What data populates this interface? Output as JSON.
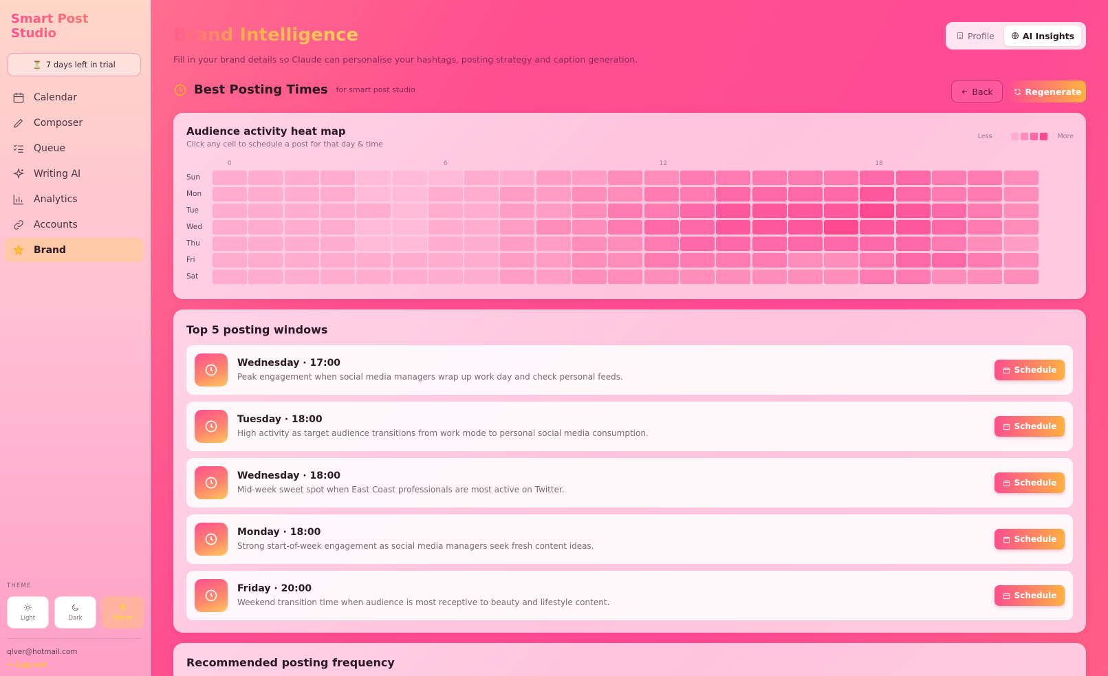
{
  "app": {
    "name": "Smart Post Studio",
    "trial": "7 days left in trial"
  },
  "sidebar": {
    "items": [
      {
        "label": "Calendar",
        "icon": "calendar-icon"
      },
      {
        "label": "Composer",
        "icon": "pen-icon"
      },
      {
        "label": "Queue",
        "icon": "list-check-icon"
      },
      {
        "label": "Writing AI",
        "icon": "sparkle-icon"
      },
      {
        "label": "Analytics",
        "icon": "bar-chart-icon"
      },
      {
        "label": "Accounts",
        "icon": "link-icon"
      },
      {
        "label": "Brand",
        "icon": "star-icon",
        "active": true
      }
    ],
    "theme_label": "THEME",
    "themes": [
      {
        "label": "Light",
        "icon": "sun-icon"
      },
      {
        "label": "Dark",
        "icon": "moon-icon"
      },
      {
        "label": "Warm",
        "icon": "bulb-icon",
        "active": true
      }
    ],
    "email": "qlver@hotmail.com",
    "logout": "Log out"
  },
  "header": {
    "title": "Brand Intelligence",
    "subtitle": "Fill in your brand details so Claude can personalise your hashtags, posting strategy and caption generation.",
    "tabs": [
      {
        "label": "Profile",
        "icon": "building-icon"
      },
      {
        "label": "AI Insights",
        "icon": "globe-icon",
        "active": true
      }
    ]
  },
  "section": {
    "title": "Best Posting Times",
    "subtitle": "for smart post studio",
    "back_label": "Back",
    "regenerate_label": "Regenerate"
  },
  "heatmap": {
    "title": "Audience activity heat map",
    "subtitle": "Click any cell to schedule a post for that day & time",
    "legend_less": "Less",
    "legend_more": "More",
    "hour_labels": [
      {
        "hour": 0,
        "label": "0"
      },
      {
        "hour": 6,
        "label": "6"
      },
      {
        "hour": 12,
        "label": "12"
      },
      {
        "hour": 18,
        "label": "18"
      }
    ],
    "days": [
      "Sun",
      "Mon",
      "Tue",
      "Wed",
      "Thu",
      "Fri",
      "Sat"
    ],
    "intensity": [
      [
        3,
        3,
        3,
        3,
        2,
        2,
        2,
        3,
        3,
        4,
        4,
        5,
        5,
        6,
        6,
        6,
        6,
        6,
        7,
        7,
        6,
        6,
        5
      ],
      [
        3,
        3,
        3,
        3,
        2,
        2,
        3,
        3,
        4,
        4,
        5,
        5,
        6,
        6,
        7,
        7,
        7,
        7,
        8,
        7,
        6,
        6,
        5
      ],
      [
        3,
        3,
        3,
        3,
        3,
        2,
        3,
        3,
        4,
        4,
        5,
        6,
        6,
        7,
        8,
        8,
        8,
        8,
        9,
        8,
        7,
        6,
        5
      ],
      [
        3,
        3,
        3,
        3,
        2,
        2,
        3,
        3,
        4,
        5,
        5,
        6,
        7,
        7,
        8,
        8,
        8,
        9,
        8,
        8,
        7,
        6,
        5
      ],
      [
        3,
        3,
        3,
        3,
        2,
        2,
        3,
        3,
        4,
        4,
        5,
        5,
        6,
        7,
        7,
        7,
        7,
        7,
        7,
        7,
        6,
        5,
        4
      ],
      [
        3,
        3,
        3,
        3,
        3,
        3,
        3,
        3,
        4,
        4,
        5,
        5,
        6,
        6,
        6,
        6,
        5,
        5,
        6,
        7,
        7,
        6,
        5
      ],
      [
        3,
        3,
        3,
        3,
        3,
        3,
        3,
        3,
        4,
        4,
        5,
        5,
        5,
        5,
        5,
        5,
        5,
        5,
        6,
        6,
        5,
        5,
        5
      ]
    ]
  },
  "windows": {
    "title": "Top 5 posting windows",
    "schedule_label": "Schedule",
    "items": [
      {
        "title": "Wednesday · 17:00",
        "desc": "Peak engagement when social media managers wrap up work day and check personal feeds."
      },
      {
        "title": "Tuesday · 18:00",
        "desc": "High activity as target audience transitions from work mode to personal social media consumption."
      },
      {
        "title": "Wednesday · 18:00",
        "desc": "Mid-week sweet spot when East Coast professionals are most active on Twitter."
      },
      {
        "title": "Monday · 18:00",
        "desc": "Strong start-of-week engagement as social media managers seek fresh content ideas."
      },
      {
        "title": "Friday · 20:00",
        "desc": "Weekend transition time when audience is most receptive to beauty and lifestyle content."
      }
    ]
  },
  "frequency": {
    "title": "Recommended posting frequency"
  },
  "colors": {
    "accent": "#ff4f8f",
    "accent_warm": "#ffb040",
    "heat_scale": [
      "#ffd3e6",
      "#ffc6dd",
      "#ffbad6",
      "#ffacce",
      "#ff9dc5",
      "#ff8cbb",
      "#ff7ab1",
      "#ff68a6",
      "#ff579c",
      "#ff4890"
    ]
  }
}
